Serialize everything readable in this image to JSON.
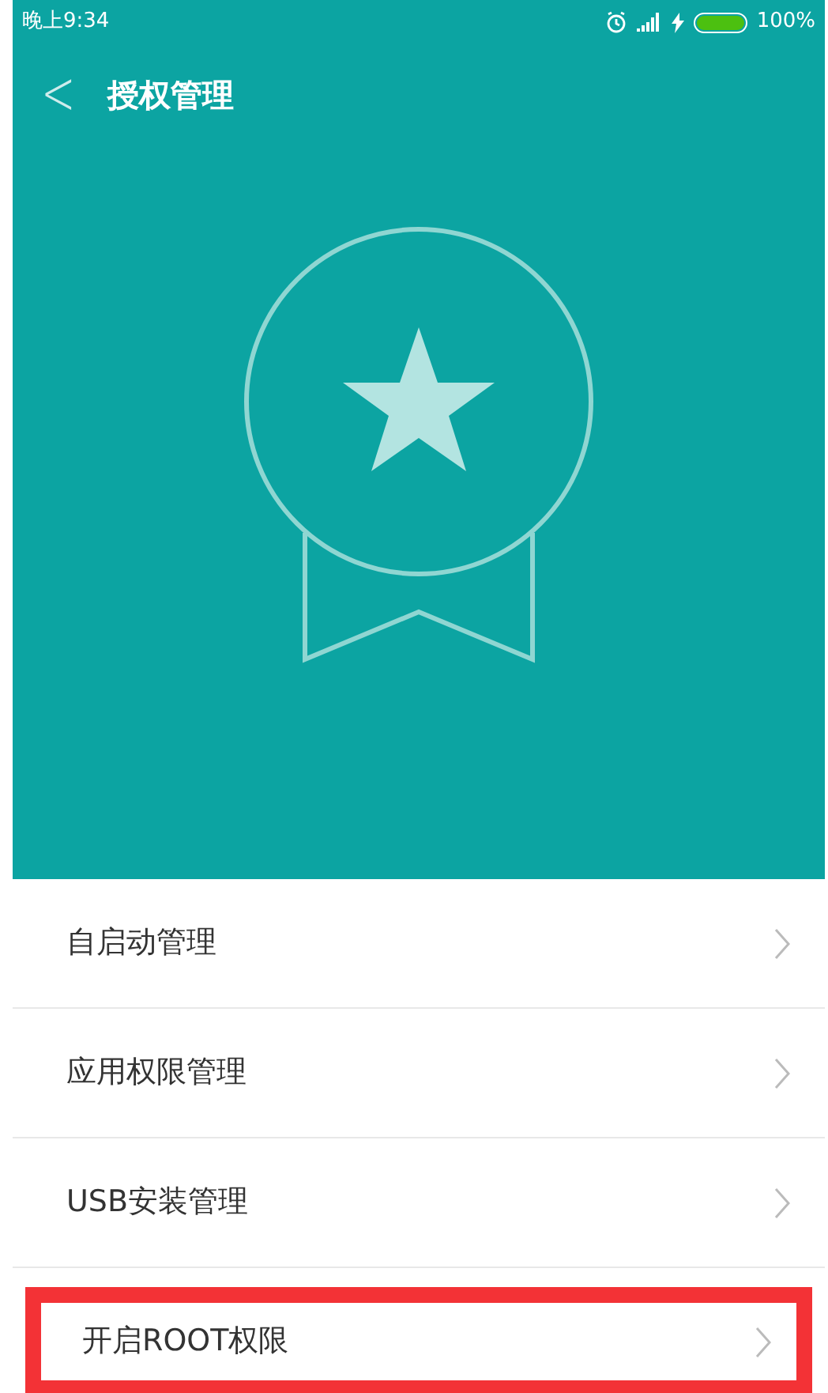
{
  "status_bar": {
    "time": "晚上9:34",
    "battery": "100%"
  },
  "header": {
    "back": "<",
    "title": "授权管理"
  },
  "menu_items": [
    {
      "label": "自启动管理",
      "highlighted": false
    },
    {
      "label": "应用权限管理",
      "highlighted": false
    },
    {
      "label": "USB安装管理",
      "highlighted": false
    },
    {
      "label": "开启ROOT权限",
      "highlighted": true
    }
  ]
}
